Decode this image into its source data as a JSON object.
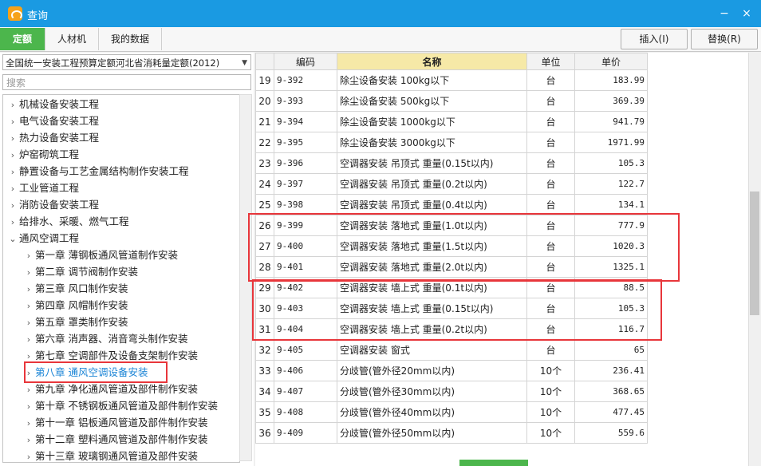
{
  "window": {
    "title": "查询",
    "min": "−",
    "close": "×"
  },
  "tabs": [
    "定额",
    "人材机",
    "我的数据"
  ],
  "buttons": {
    "insert": "插入(I)",
    "replace": "替换(R)"
  },
  "left": {
    "select_value": "全国统一安装工程预算定额河北省消耗量定额(2012)",
    "search_placeholder": "搜索",
    "tree": [
      {
        "label": "机械设备安装工程",
        "level": 0,
        "state": "collapsed"
      },
      {
        "label": "电气设备安装工程",
        "level": 0,
        "state": "collapsed"
      },
      {
        "label": "热力设备安装工程",
        "level": 0,
        "state": "collapsed"
      },
      {
        "label": "炉窑砌筑工程",
        "level": 0,
        "state": "collapsed"
      },
      {
        "label": "静置设备与工艺金属结构制作安装工程",
        "level": 0,
        "state": "collapsed"
      },
      {
        "label": "工业管道工程",
        "level": 0,
        "state": "collapsed"
      },
      {
        "label": "消防设备安装工程",
        "level": 0,
        "state": "collapsed"
      },
      {
        "label": "给排水、采暖、燃气工程",
        "level": 0,
        "state": "collapsed"
      },
      {
        "label": "通风空调工程",
        "level": 0,
        "state": "expanded"
      },
      {
        "label": "第一章 薄钢板通风管道制作安装",
        "level": 1,
        "state": "collapsed"
      },
      {
        "label": "第二章 调节阀制作安装",
        "level": 1,
        "state": "collapsed"
      },
      {
        "label": "第三章 风口制作安装",
        "level": 1,
        "state": "collapsed"
      },
      {
        "label": "第四章 风帽制作安装",
        "level": 1,
        "state": "collapsed"
      },
      {
        "label": "第五章 罩类制作安装",
        "level": 1,
        "state": "collapsed"
      },
      {
        "label": "第六章 消声器、消音弯头制作安装",
        "level": 1,
        "state": "collapsed"
      },
      {
        "label": "第七章 空调部件及设备支架制作安装",
        "level": 1,
        "state": "collapsed"
      },
      {
        "label": "第八章 通风空调设备安装",
        "level": 1,
        "state": "selected"
      },
      {
        "label": "第九章 净化通风管道及部件制作安装",
        "level": 1,
        "state": "collapsed"
      },
      {
        "label": "第十章 不锈钢板通风管道及部件制作安装",
        "level": 1,
        "state": "collapsed"
      },
      {
        "label": "第十一章 铝板通风管道及部件制作安装",
        "level": 1,
        "state": "collapsed"
      },
      {
        "label": "第十二章 塑料通风管道及部件制作安装",
        "level": 1,
        "state": "collapsed"
      },
      {
        "label": "第十三章 玻璃钢通风管道及部件安装",
        "level": 1,
        "state": "collapsed"
      }
    ]
  },
  "table": {
    "headers": [
      "",
      "编码",
      "名称",
      "单位",
      "单价"
    ],
    "rows": [
      [
        "19",
        "9-392",
        "除尘设备安装 100kg以下",
        "台",
        "183.99"
      ],
      [
        "20",
        "9-393",
        "除尘设备安装 500kg以下",
        "台",
        "369.39"
      ],
      [
        "21",
        "9-394",
        "除尘设备安装 1000kg以下",
        "台",
        "941.79"
      ],
      [
        "22",
        "9-395",
        "除尘设备安装 3000kg以下",
        "台",
        "1971.99"
      ],
      [
        "23",
        "9-396",
        "空调器安装 吊顶式 重量(0.15t以内)",
        "台",
        "105.3"
      ],
      [
        "24",
        "9-397",
        "空调器安装 吊顶式 重量(0.2t以内)",
        "台",
        "122.7"
      ],
      [
        "25",
        "9-398",
        "空调器安装 吊顶式 重量(0.4t以内)",
        "台",
        "134.1"
      ],
      [
        "26",
        "9-399",
        "空调器安装 落地式 重量(1.0t以内)",
        "台",
        "777.9"
      ],
      [
        "27",
        "9-400",
        "空调器安装 落地式 重量(1.5t以内)",
        "台",
        "1020.3"
      ],
      [
        "28",
        "9-401",
        "空调器安装 落地式 重量(2.0t以内)",
        "台",
        "1325.1"
      ],
      [
        "29",
        "9-402",
        "空调器安装 墙上式 重量(0.1t以内)",
        "台",
        "88.5"
      ],
      [
        "30",
        "9-403",
        "空调器安装 墙上式 重量(0.15t以内)",
        "台",
        "105.3"
      ],
      [
        "31",
        "9-404",
        "空调器安装 墙上式 重量(0.2t以内)",
        "台",
        "116.7"
      ],
      [
        "32",
        "9-405",
        "空调器安装 窗式",
        "台",
        "65"
      ],
      [
        "33",
        "9-406",
        "分歧管(管外径20mm以内)",
        "10个",
        "236.41"
      ],
      [
        "34",
        "9-407",
        "分歧管(管外径30mm以内)",
        "10个",
        "368.65"
      ],
      [
        "35",
        "9-408",
        "分歧管(管外径40mm以内)",
        "10个",
        "477.45"
      ],
      [
        "36",
        "9-409",
        "分歧管(管外径50mm以内)",
        "10个",
        "559.6"
      ]
    ]
  },
  "colors": {
    "titlebar": "#1a9ae2",
    "active_tab": "#4cb64c",
    "highlight": "#e8363b",
    "name_header": "#f6e9a7"
  }
}
